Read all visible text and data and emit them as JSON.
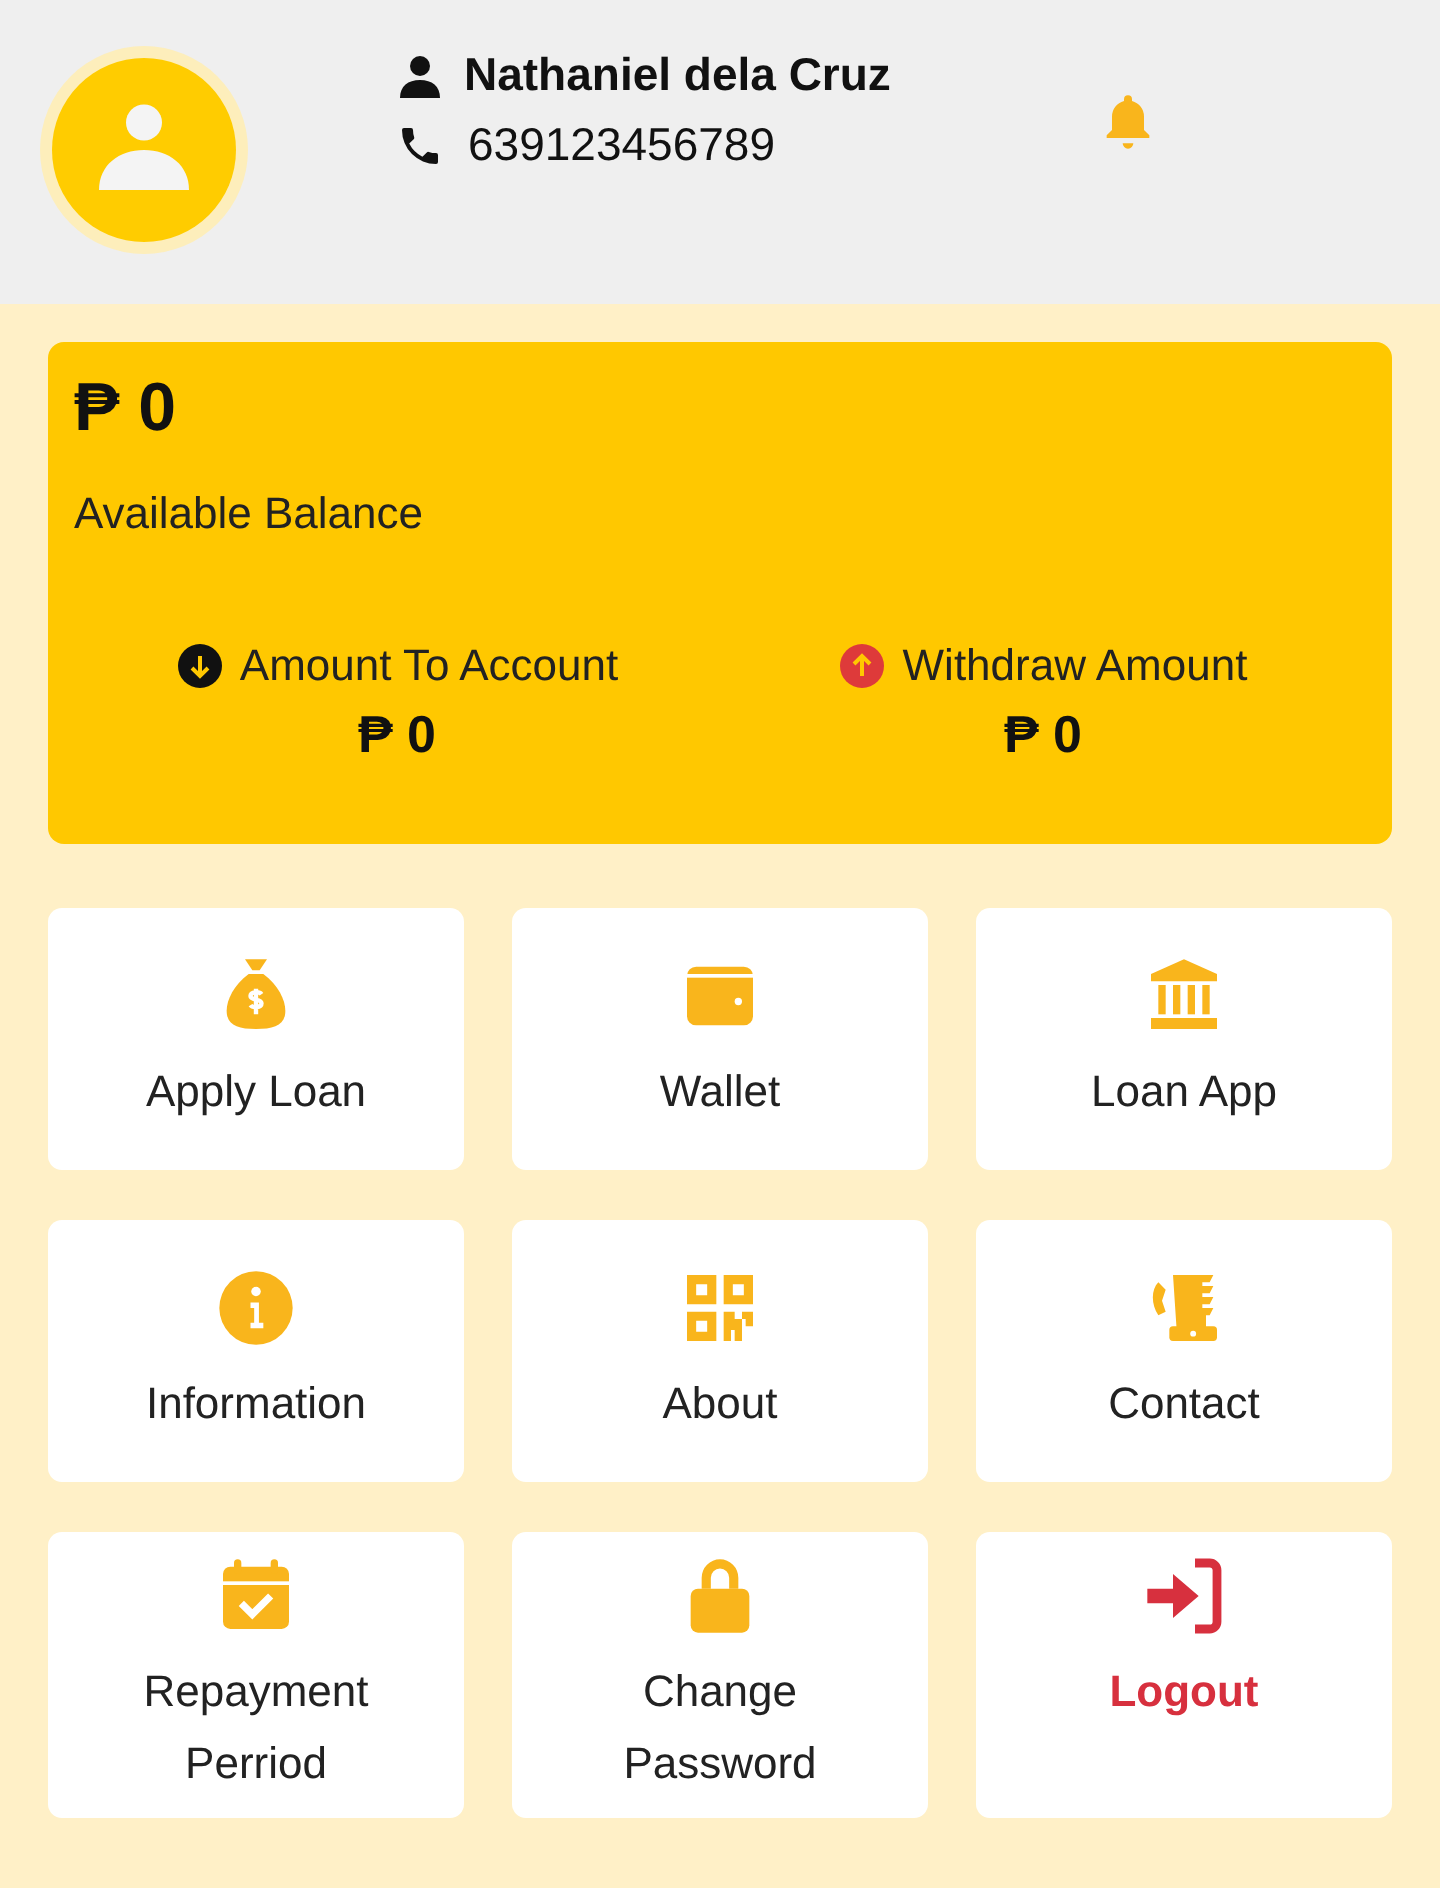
{
  "profile": {
    "name": "Nathaniel dela Cruz",
    "phone": "639123456789"
  },
  "balance": {
    "amount": "₱ 0",
    "label": "Available Balance",
    "stats": [
      {
        "kind": "in",
        "label": "Amount To Account",
        "amount": "₱ 0"
      },
      {
        "kind": "out",
        "label": "Withdraw Amount",
        "amount": "₱ 0"
      }
    ]
  },
  "menu": [
    {
      "kind": "loan",
      "label": [
        "Apply Loan"
      ]
    },
    {
      "kind": "wallet",
      "label": [
        "Wallet"
      ]
    },
    {
      "kind": "bank",
      "label": [
        "Loan App"
      ]
    },
    {
      "kind": "info",
      "label": [
        "Information"
      ]
    },
    {
      "kind": "qr",
      "label": [
        "About"
      ]
    },
    {
      "kind": "phone",
      "label": [
        "Contact"
      ]
    },
    {
      "kind": "calendar",
      "label": [
        "Repayment",
        "Perriod"
      ]
    },
    {
      "kind": "lock",
      "label": [
        "Change",
        "Password"
      ]
    },
    {
      "kind": "logout",
      "label": [
        "Logout"
      ]
    }
  ]
}
